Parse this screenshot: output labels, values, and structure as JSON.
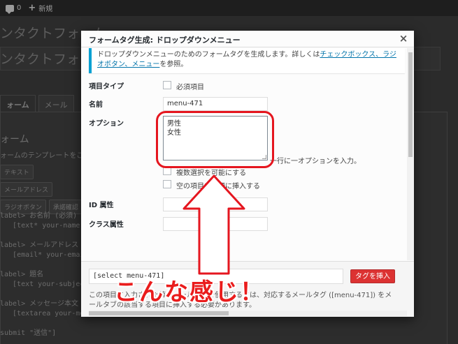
{
  "admin_bar": {
    "comments_count": "0",
    "new_label": "新規"
  },
  "background": {
    "page_title": "ンタクトフォーム",
    "page_title2": "ンタクトフォー",
    "tabs": [
      "ォーム",
      "メール"
    ],
    "section_title": "ォーム",
    "section_desc": "ォームのテンプレートをこ",
    "tag_buttons": [
      "テキスト",
      "メールアドレス",
      "ラジオボタン",
      "承諾確認"
    ],
    "code_lines": [
      "label> お名前 (必須)",
      "   [text* your-name]",
      "",
      "label> メールアドレス",
      "   [email* your-email",
      "",
      "label> 題名",
      "   [text your-subjec",
      "",
      "label> メッセージ本文",
      "   [textarea your-me",
      "",
      "submit \"送信\"]"
    ]
  },
  "modal": {
    "title": "フォームタグ生成: ドロップダウンメニュー",
    "close_symbol": "×",
    "notice": {
      "text_before": "ドロップダウンメニューのためのフォームタグを生成します。詳しくは",
      "link": "チェックボックス、ラジオボタン、メニュー",
      "text_after": "を参照。"
    },
    "fields": {
      "field_type_label": "項目タイプ",
      "required_label": "必須項目",
      "name_label": "名前",
      "name_value": "menu-471",
      "options_label": "オプション",
      "options_lines": [
        "男性",
        "女性"
      ],
      "options_hint": "一行に一オプションを入力。",
      "multiple_label": "複数選択を可能にする",
      "blank_first_label": "空の項目を先頭に挿入する",
      "id_label": "ID 属性",
      "id_value": "",
      "class_label": "クラス属性",
      "class_value": ""
    },
    "footer": {
      "tag_output": "[select menu-471]",
      "insert_button": "タグを挿入",
      "description": "この項目に入力された値をメールの中で使用するには、対応するメールタグ ([menu-471]) をメールタブの該当する項目に挿入する必要があります。"
    }
  },
  "annotation": {
    "caption": "こんな感じ！",
    "color": "#e5161f"
  }
}
